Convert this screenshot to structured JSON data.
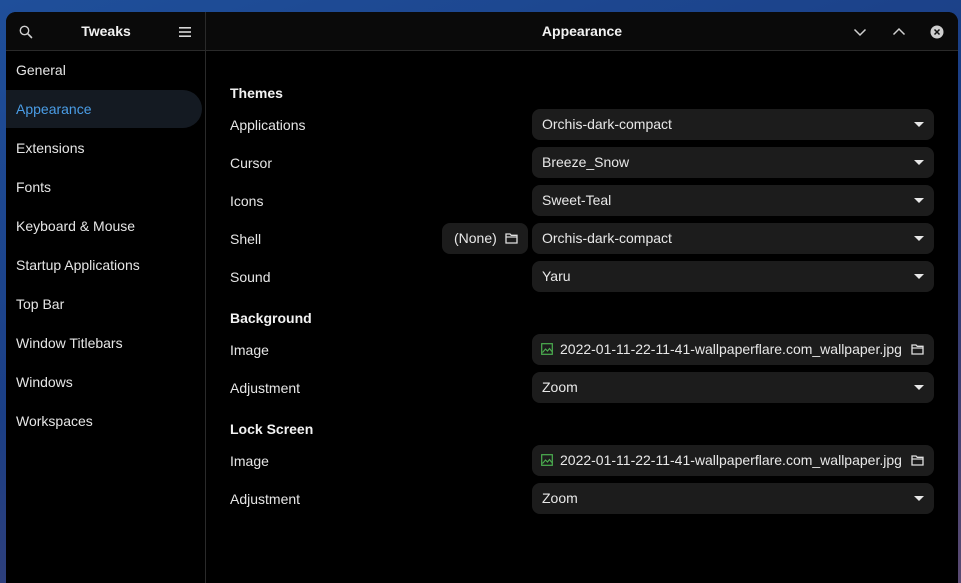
{
  "header": {
    "sidebar_title": "Tweaks",
    "page_title": "Appearance"
  },
  "sidebar": {
    "items": [
      {
        "label": "General"
      },
      {
        "label": "Appearance",
        "active": true
      },
      {
        "label": "Extensions"
      },
      {
        "label": "Fonts"
      },
      {
        "label": "Keyboard & Mouse"
      },
      {
        "label": "Startup Applications"
      },
      {
        "label": "Top Bar"
      },
      {
        "label": "Window Titlebars"
      },
      {
        "label": "Windows"
      },
      {
        "label": "Workspaces"
      }
    ]
  },
  "themes": {
    "title": "Themes",
    "applications": {
      "label": "Applications",
      "value": "Orchis-dark-compact"
    },
    "cursor": {
      "label": "Cursor",
      "value": "Breeze_Snow"
    },
    "icons": {
      "label": "Icons",
      "value": "Sweet-Teal"
    },
    "shell": {
      "label": "Shell",
      "file_value": "(None)",
      "value": "Orchis-dark-compact"
    },
    "sound": {
      "label": "Sound",
      "value": "Yaru"
    }
  },
  "background": {
    "title": "Background",
    "image": {
      "label": "Image",
      "value": "2022-01-11-22-11-41-wallpaperflare.com_wallpaper.jpg"
    },
    "adjustment": {
      "label": "Adjustment",
      "value": "Zoom"
    }
  },
  "lock_screen": {
    "title": "Lock Screen",
    "image": {
      "label": "Image",
      "value": "2022-01-11-22-11-41-wallpaperflare.com_wallpaper.jpg"
    },
    "adjustment": {
      "label": "Adjustment",
      "value": "Zoom"
    }
  },
  "icons": {
    "search": "search-icon",
    "menu": "hamburger-menu-icon",
    "minimize": "chevron-down-icon",
    "maximize": "chevron-up-icon",
    "close": "close-icon",
    "folder": "folder-icon",
    "image": "image-file-icon"
  },
  "colors": {
    "accent": "#4a9de6",
    "window_bg": "#000000",
    "control_bg": "#1c1c1c",
    "image_icon": "#4caf50"
  }
}
